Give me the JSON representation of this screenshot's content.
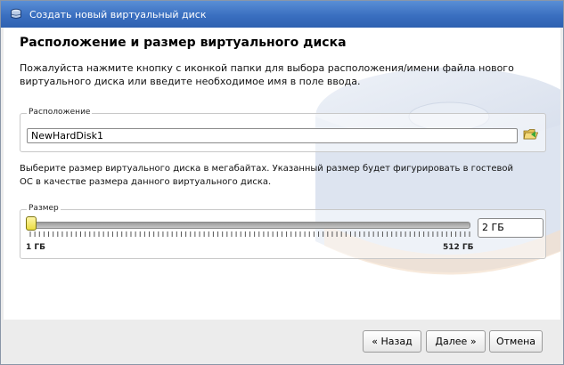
{
  "window": {
    "title": "Создать новый виртуальный диск",
    "title_icon": "virtualbox-disk-icon"
  },
  "page": {
    "heading": "Расположение и размер виртуального диска",
    "description": "Пожалуйста нажмите кнопку с иконкой папки для выбора расположения/имени файла нового виртуального диска или введите необходимое имя в поле ввода."
  },
  "location": {
    "legend": "Расположение",
    "value": "NewHardDisk1",
    "folder_icon": "folder-open-icon"
  },
  "size": {
    "description": "Выберите размер виртуального диска в мегабайтах. Указанный размер будет фигурировать в гостевой ОС в качестве размера данного виртуального диска.",
    "legend": "Размер",
    "slider_min_label": "1 ГБ",
    "slider_max_label": "512 ГБ",
    "value": "2 ГБ",
    "slider_fraction": 0.002
  },
  "buttons": {
    "back": "« Назад",
    "next": "Далее »",
    "cancel": "Отмена"
  },
  "colors": {
    "titlebar": "#3a6fc0",
    "thumb": "#eadc40",
    "dialog_bg": "#ececec"
  }
}
